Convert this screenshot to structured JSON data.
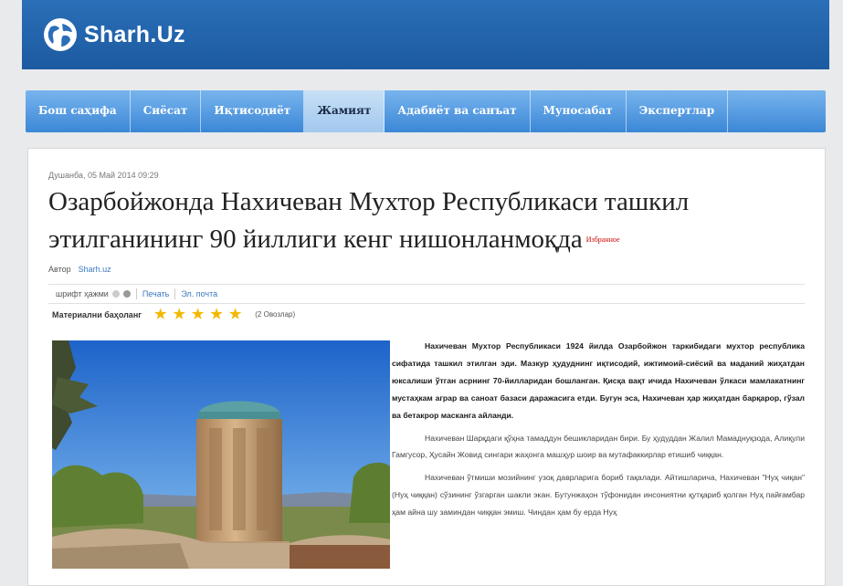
{
  "site": {
    "name": "Sharh.Uz"
  },
  "nav": {
    "items": [
      {
        "label": "Бош саҳифа"
      },
      {
        "label": "Сиёсат"
      },
      {
        "label": "Иқтисодиёт"
      },
      {
        "label": "Жамият",
        "active": true
      },
      {
        "label": "Адабиёт ва санъат"
      },
      {
        "label": "Муносабат"
      },
      {
        "label": "Экспертлар"
      }
    ]
  },
  "article": {
    "date": "Душанба, 05 Май 2014 09:29",
    "title": "Озарбойжонда Нахичеван Мухтор Республикаси ташкил этилганининг 90 йиллиги кенг нишонланмоқда",
    "favorite_label": "Избранное",
    "author_label": "Автор",
    "author_name": "Sharh.uz",
    "font_size_label": "шрифт ҳажми",
    "print_label": "Печать",
    "email_label": "Эл. почта",
    "rating_label": "Материални баҳоланг",
    "rating": 5,
    "votes": "(2 Овозлар)",
    "paragraphs": [
      {
        "style": "lead",
        "text": "Нахичеван Мухтор Республикаси 1924 йилда Озарбойжон таркибидаги мухтор республика сифатида ташкил этилган эди. Мазкур ҳудуднинг иқтисодий, ижтимоий-сиёсий ва маданий жиҳатдан юксалиши ўтган асрнинг 70-йилларидан бошланган. Қисқа вақт ичида Нахичеван ўлкаси мамлакатнинг мустаҳкам аграр ва саноат базаси даражасига етди. Бугун эса, Нахичеван ҳар жиҳатдан барқарор, гўзал ва бетакрор масканга айланди."
      },
      {
        "style": "body",
        "text": "Нахичеван Шарқдаги қўҳна тамаддун бешикларидан бири. Бу ҳудуддан Жалил Мамаднуқзода, Алиқули Гамгусор, Ҳусайн Жовид сингари жаҳонга машҳур шоир ва мутафаккирлар етишиб чиққан."
      },
      {
        "style": "body",
        "text": "Нахичеван ўтмиши мозийнинг узоқ даврларига бориб тақалади. Айтишларича, Нахичеван \"Нуҳ чиқан\" (Нуҳ чиққан) сўзининг ўзгарган шакли экан. Бутунжаҳон тўфонидан инсониятни қутқариб қолган Нуҳ пайғамбар ҳам айна шу заминдан чиққан эмиш. Чиндан ҳам бу ерда Нуҳ"
      }
    ]
  }
}
